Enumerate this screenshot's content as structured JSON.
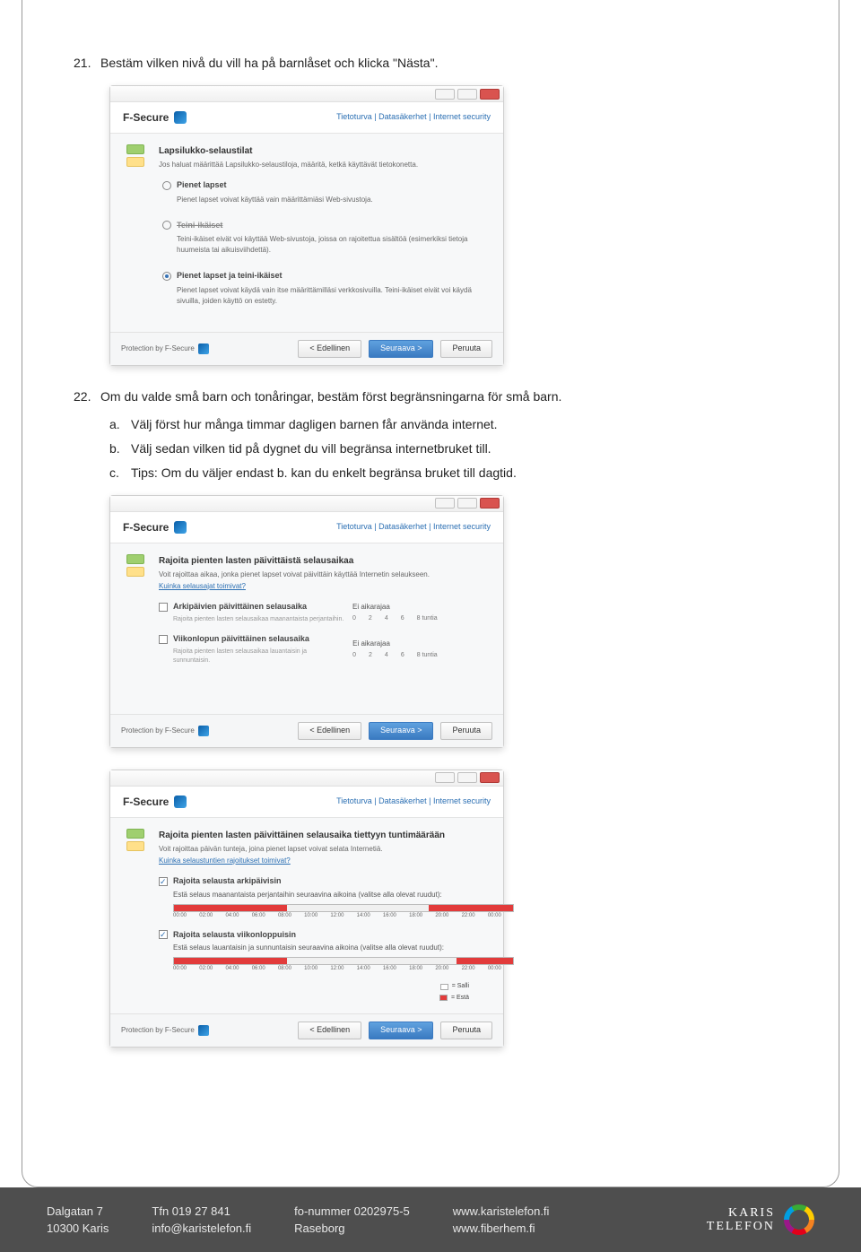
{
  "item21": {
    "num": "21.",
    "text": "Bestäm vilken nivå du vill ha på barnlåset och klicka \"Nästa\"."
  },
  "item22": {
    "num": "22.",
    "text": "Om du valde små barn och tonåringar, bestäm först begränsningarna för små barn.",
    "a": {
      "letter": "a.",
      "text": "Välj först hur många timmar dagligen barnen får använda internet."
    },
    "b": {
      "letter": "b.",
      "text": "Välj sedan vilken tid på dygnet du vill begränsa internetbruket till."
    },
    "c": {
      "letter": "c.",
      "text": "Tips: Om du väljer endast b. kan du enkelt begränsa bruket till dagtid."
    }
  },
  "win_common": {
    "brand": "F-Secure",
    "breadcrumb": "Tietoturva | Datasäkerhet | Internet security",
    "back": "< Edellinen",
    "next": "Seuraava >",
    "cancel": "Peruuta",
    "protection": "Protection by F-Secure"
  },
  "win1": {
    "title": "Lapsilukko-selaustilat",
    "desc": "Jos haluat määrittää Lapsilukko-selaustiloja, määritä, ketkä käyttävät tietokonetta.",
    "r1": {
      "label": "Pienet lapset",
      "desc": "Pienet lapset voivat käyttää vain määrittämiäsi Web-sivustoja."
    },
    "r2": {
      "label": "Teini-ikäiset",
      "desc": "Teini-ikäiset eivät voi käyttää Web-sivustoja, joissa on rajoitettua sisältöä (esimerkiksi tietoja huumeista tai aikuisviihdettä)."
    },
    "r3": {
      "label": "Pienet lapset ja teini-ikäiset",
      "desc": "Pienet lapset voivat käydä vain itse määrittämilläsi verkkosivuilla. Teini-ikäiset eivät voi käydä sivuilla, joiden käyttö on estetty."
    }
  },
  "win2": {
    "title": "Rajoita pienten lasten päivittäistä selausaikaa",
    "desc": "Voit rajoittaa aikaa, jonka pienet lapset voivat päivittäin käyttää Internetin selaukseen.",
    "link": "Kuinka selausajat toimivat?",
    "chk1": {
      "label": "Arkipäivien päivittäinen selausaika",
      "sub": "Rajoita pienten lasten selausaikaa maanantaista perjantaihin.",
      "right": "Ei aikarajaa",
      "ticks": [
        "0",
        "2",
        "4",
        "6",
        "8 tuntia"
      ]
    },
    "chk2": {
      "label": "Viikonlopun päivittäinen selausaika",
      "sub": "Rajoita pienten lasten selausaikaa lauantaisin ja sunnuntaisin.",
      "right": "Ei aikarajaa",
      "ticks": [
        "0",
        "2",
        "4",
        "6",
        "8 tuntia"
      ]
    }
  },
  "win3": {
    "title": "Rajoita pienten lasten päivittäinen selausaika tiettyyn tuntimäärään",
    "desc": "Voit rajoittaa päivän tunteja, joina pienet lapset voivat selata Internetiä.",
    "link": "Kuinka selaustuntien rajoitukset toimivat?",
    "chk1": {
      "label": "Rajoita selausta arkipäivisin",
      "sub": "Estä selaus maanantaista perjantaihin seuraavina aikoina (valitse alla olevat ruudut):"
    },
    "chk2": {
      "label": "Rajoita selausta viikonloppuisin",
      "sub": "Estä selaus lauantaisin ja sunnuntaisin seuraavina aikoina (valitse alla olevat ruudut):"
    },
    "timelabels": [
      "00:00",
      "02:00",
      "04:00",
      "06:00",
      "08:00",
      "10:00",
      "12:00",
      "14:00",
      "16:00",
      "18:00",
      "20:00",
      "22:00",
      "00:00"
    ],
    "legend_on": "= Salli",
    "legend_off": "= Estä"
  },
  "footer": {
    "addr1": "Dalgatan 7",
    "addr2": "10300 Karis",
    "tfn1": "Tfn 019 27 841",
    "tfn2": "info@karistelefon.fi",
    "fo1": "fo-nummer 0202975-5",
    "fo2": "Raseborg",
    "web1": "www.karistelefon.fi",
    "web2": "www.fiberhem.fi",
    "logo1": "KARIS",
    "logo2": "TELEFON"
  }
}
